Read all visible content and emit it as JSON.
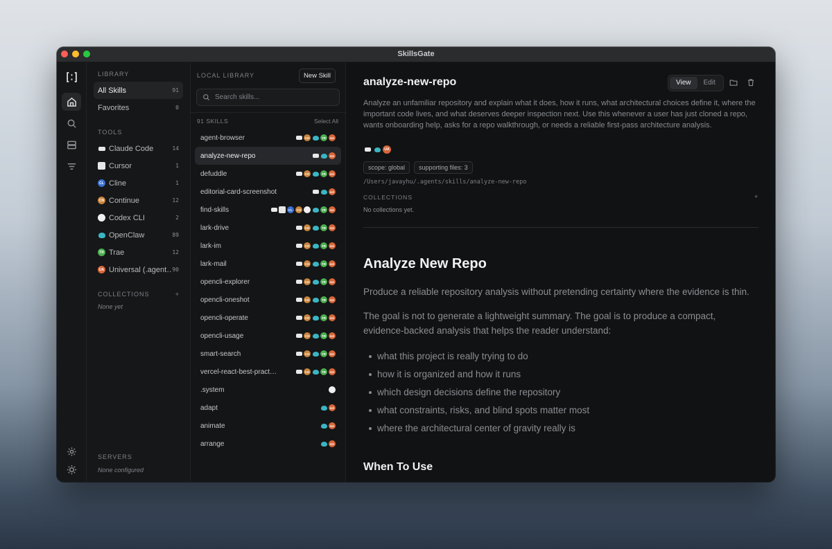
{
  "window": {
    "title": "SkillsGate"
  },
  "sidebar": {
    "library_label": "LIBRARY",
    "library_items": [
      {
        "label": "All Skills",
        "count": "91"
      },
      {
        "label": "Favorites",
        "count": "0"
      }
    ],
    "tools_label": "TOOLS",
    "tools": [
      {
        "label": "Claude Code",
        "count": "14",
        "icon": "claude-code-icon"
      },
      {
        "label": "Cursor",
        "count": "1",
        "icon": "cursor-icon"
      },
      {
        "label": "Cline",
        "count": "1",
        "icon": "cline-icon"
      },
      {
        "label": "Continue",
        "count": "12",
        "icon": "continue-icon"
      },
      {
        "label": "Codex CLI",
        "count": "2",
        "icon": "codex-icon"
      },
      {
        "label": "OpenClaw",
        "count": "89",
        "icon": "openclaw-icon"
      },
      {
        "label": "Trae",
        "count": "12",
        "icon": "trae-icon"
      },
      {
        "label": "Universal (.agent…",
        "count": "90",
        "icon": "universal-icon"
      }
    ],
    "collections_label": "COLLECTIONS",
    "collections_add": "+",
    "collections_empty": "None yet",
    "servers_label": "SERVERS",
    "servers_empty": "None configured"
  },
  "list": {
    "header": "LOCAL LIBRARY",
    "new_button": "New Skill",
    "search_placeholder": "Search skills...",
    "count_label": "91 SKILLS",
    "select_all": "Select All",
    "skills": [
      {
        "name": "agent-browser",
        "badges": [
          "cc",
          "co",
          "oc",
          "tr",
          "ua"
        ]
      },
      {
        "name": "analyze-new-repo",
        "badges": [
          "cc",
          "oc",
          "ua"
        ]
      },
      {
        "name": "defuddle",
        "badges": [
          "cc",
          "co",
          "oc",
          "tr",
          "ua"
        ]
      },
      {
        "name": "editorial-card-screenshot",
        "badges": [
          "cc",
          "oc",
          "ua"
        ]
      },
      {
        "name": "find-skills",
        "badges": [
          "cc",
          "cu",
          "cl",
          "co",
          "cx",
          "oc",
          "tr",
          "ua"
        ]
      },
      {
        "name": "lark-drive",
        "badges": [
          "cc",
          "co",
          "oc",
          "tr",
          "ua"
        ]
      },
      {
        "name": "lark-im",
        "badges": [
          "cc",
          "co",
          "oc",
          "tr",
          "ua"
        ]
      },
      {
        "name": "lark-mail",
        "badges": [
          "cc",
          "co",
          "oc",
          "tr",
          "ua"
        ]
      },
      {
        "name": "opencli-explorer",
        "badges": [
          "cc",
          "co",
          "oc",
          "tr",
          "ua"
        ]
      },
      {
        "name": "opencli-oneshot",
        "badges": [
          "cc",
          "co",
          "oc",
          "tr",
          "ua"
        ]
      },
      {
        "name": "opencli-operate",
        "badges": [
          "cc",
          "co",
          "oc",
          "tr",
          "ua"
        ]
      },
      {
        "name": "opencli-usage",
        "badges": [
          "cc",
          "co",
          "oc",
          "tr",
          "ua"
        ]
      },
      {
        "name": "smart-search",
        "badges": [
          "cc",
          "co",
          "oc",
          "tr",
          "ua"
        ]
      },
      {
        "name": "vercel-react-best-pract…",
        "badges": [
          "cc",
          "co",
          "oc",
          "tr",
          "ua"
        ]
      },
      {
        "name": ".system",
        "badges": [
          "cx"
        ]
      },
      {
        "name": "adapt",
        "badges": [
          "oc",
          "ua"
        ]
      },
      {
        "name": "animate",
        "badges": [
          "oc",
          "ua"
        ]
      },
      {
        "name": "arrange",
        "badges": [
          "oc",
          "ua"
        ]
      }
    ],
    "selected_index": 1
  },
  "badge_labels": {
    "cc": "",
    "co": "CO",
    "oc": "",
    "tr": "TR",
    "ua": "UA",
    "cl": "CL",
    "cu": "",
    "cx": ""
  },
  "detail": {
    "title": "analyze-new-repo",
    "view_label": "View",
    "edit_label": "Edit",
    "description": "Analyze an unfamiliar repository and explain what it does, how it runs, what architectural choices define it, where the important code lives, and what deserves deeper inspection next. Use this whenever a user has just cloned a repo, wants onboarding help, asks for a repo walkthrough, or needs a reliable first-pass architecture analysis.",
    "badges": [
      "cc",
      "oc",
      "ua"
    ],
    "scope_chip": "scope: global",
    "files_chip": "supporting files: 3",
    "path": "/Users/javayhu/.agents/skills/analyze-new-repo",
    "collections_label": "COLLECTIONS",
    "collections_add": "+",
    "collections_empty": "No collections yet.",
    "md_title": "Analyze New Repo",
    "md_p1": "Produce a reliable repository analysis without pretending certainty where the evidence is thin.",
    "md_p2": "The goal is not to generate a lightweight summary. The goal is to produce a compact, evidence-backed analysis that helps the reader understand:",
    "md_list": [
      "what this project is really trying to do",
      "how it is organized and how it runs",
      "which design decisions define the repository",
      "what constraints, risks, and blind spots matter most",
      "where the architectural center of gravity really is"
    ],
    "md_h2": "When To Use"
  }
}
